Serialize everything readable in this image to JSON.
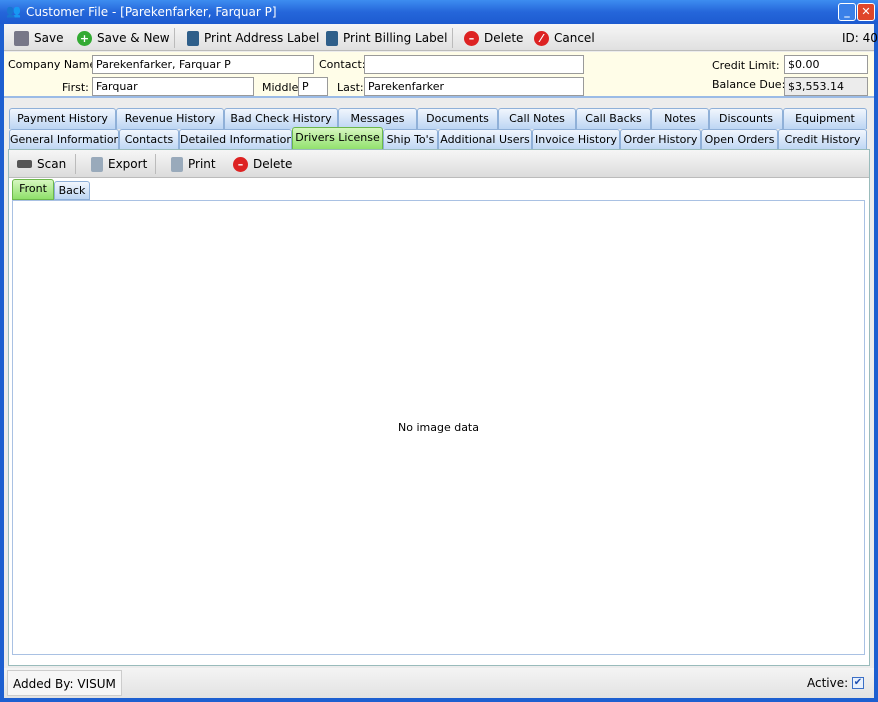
{
  "window": {
    "title": "Customer File - [Parekenfarker, Farquar P]",
    "minimize": "_",
    "close": "✕"
  },
  "toolbar": {
    "save": "Save",
    "save_new": "Save & New",
    "print_address": "Print Address Label",
    "print_billing": "Print Billing Label",
    "delete": "Delete",
    "cancel": "Cancel",
    "id": "ID: 40"
  },
  "header": {
    "company_label": "Company Name:",
    "company": "Parekenfarker, Farquar P",
    "contact_label": "Contact:",
    "contact": "",
    "first_label": "First:",
    "first": "Farquar",
    "middle_label": "Middle:",
    "middle": "P",
    "last_label": "Last:",
    "last": "Parekenfarker",
    "credit_label": "Credit Limit:",
    "credit": "$0.00",
    "balance_label": "Balance Due:",
    "balance": "$3,553.14"
  },
  "tabs_row1": [
    "Payment History",
    "Revenue History",
    "Bad Check History",
    "Messages",
    "Documents",
    "Call Notes",
    "Call Backs",
    "Notes",
    "Discounts",
    "Equipment"
  ],
  "tabs_row2": [
    "General Information",
    "Contacts",
    "Detailed Information",
    "Drivers License",
    "Ship To's",
    "Additional Users",
    "Invoice History",
    "Order History",
    "Open Orders",
    "Credit History"
  ],
  "active_tab": "Drivers License",
  "sub_toolbar": {
    "scan": "Scan",
    "export": "Export",
    "print": "Print",
    "delete": "Delete"
  },
  "sub_tabs": [
    "Front",
    "Back"
  ],
  "active_sub_tab": "Front",
  "image": {
    "message": "No image data"
  },
  "footer": {
    "added_by": "Added By: VISUM",
    "active_label": "Active:",
    "active": true
  }
}
